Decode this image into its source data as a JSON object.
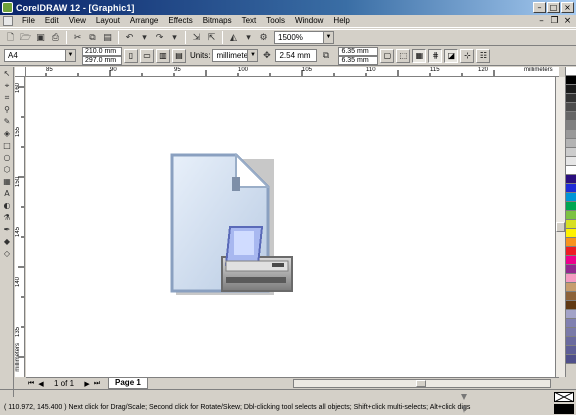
{
  "window": {
    "title": "CorelDRAW 12 - [Graphic1]"
  },
  "menu": [
    "File",
    "Edit",
    "View",
    "Layout",
    "Arrange",
    "Effects",
    "Bitmaps",
    "Text",
    "Tools",
    "Window",
    "Help"
  ],
  "toolbar": {
    "zoom": "1500%"
  },
  "property_bar": {
    "paper": "A4",
    "width": "210.0 mm",
    "height": "297.0 mm",
    "units_label": "Units:",
    "units": "millimeters",
    "nudge": "2.54 mm",
    "dup_x": "6.35 mm",
    "dup_y": "6.35 mm"
  },
  "ruler": {
    "h_ticks": [
      "85",
      "90",
      "95",
      "100",
      "105",
      "110",
      "115",
      "120"
    ],
    "h_unit": "millimeters",
    "v_ticks": [
      "160",
      "155",
      "150",
      "145",
      "140",
      "135"
    ],
    "v_unit": "millimeters"
  },
  "pages": {
    "count_label": "1 of 1",
    "tab": "Page 1"
  },
  "status": {
    "text": "( 110.972, 145.400 )     Next click for Drag/Scale; Second click for Rotate/Skew; Dbl-clicking tool selects all objects; Shift+click multi-selects; Alt+click digs"
  },
  "palette": [
    "#ffffff",
    "#000000",
    "#1a1a1a",
    "#333333",
    "#4d4d4d",
    "#666666",
    "#808080",
    "#999999",
    "#b3b3b3",
    "#cccccc",
    "#e6e6e6",
    "#ffffff",
    "#2b0f7e",
    "#1e2bd6",
    "#0096d6",
    "#00a651",
    "#7dc242",
    "#d7df23",
    "#fff200",
    "#f7941d",
    "#ed1c24",
    "#ec008c",
    "#92278f",
    "#f49ac1",
    "#c69c6d",
    "#8c6239",
    "#603913",
    "#a3a3c8",
    "#8080b0",
    "#7a7aa8",
    "#6a6a9e",
    "#5e5e96",
    "#4f4f8a"
  ]
}
